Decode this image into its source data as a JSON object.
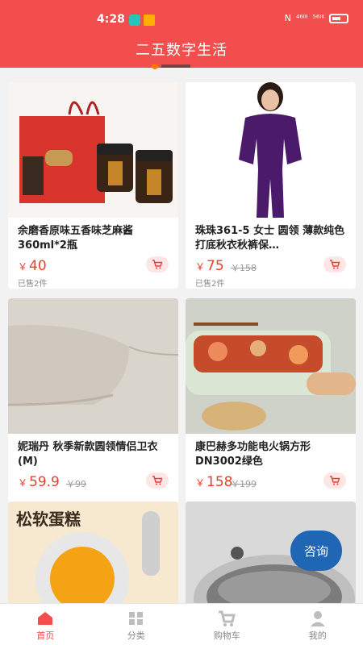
{
  "status": {
    "time": "4:28",
    "net1": "⁴⁶ᴵˡˡ",
    "net2": "⁵⁶ᴵˡˡ"
  },
  "app": {
    "title": "二五数字生活",
    "accent": "#f24e4e"
  },
  "products": [
    {
      "name": "余磨香原味五香味芝麻酱360ml*2瓶",
      "currency": "￥",
      "price": "40",
      "old_price": "",
      "sold": "已售2件"
    },
    {
      "name": "珠珠361-5 女士 圆领 薄款纯色打底秋衣秋裤保…",
      "currency": "￥",
      "price": "75",
      "old_price": "￥158",
      "sold": "已售2件"
    },
    {
      "name": "妮瑞丹 秋季新款圆领情侣卫衣(M)",
      "currency": "￥",
      "price": "59.9",
      "old_price": "￥99",
      "sold": ""
    },
    {
      "name": "康巴赫多功能电火锅方形DN3002绿色",
      "currency": "￥",
      "price": "158",
      "old_price": "￥199",
      "sold": ""
    }
  ],
  "banner5": {
    "text": "松软蛋糕"
  },
  "consult": {
    "label": "咨询"
  },
  "tabs": [
    {
      "label": "首页",
      "icon": "home-icon",
      "active": true
    },
    {
      "label": "分类",
      "icon": "category-icon",
      "active": false
    },
    {
      "label": "购物车",
      "icon": "cart-icon",
      "active": false
    },
    {
      "label": "我的",
      "icon": "user-icon",
      "active": false
    }
  ]
}
